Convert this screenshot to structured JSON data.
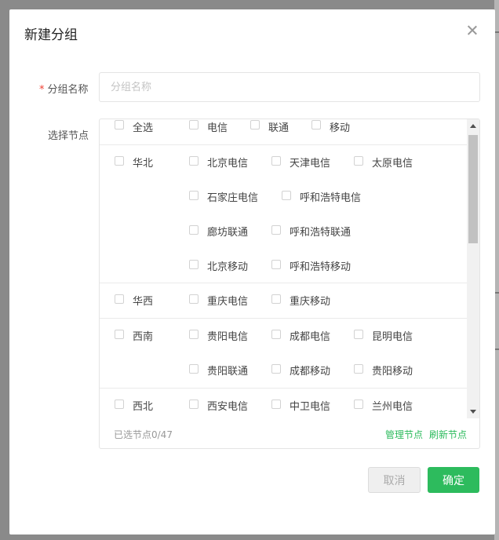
{
  "dialog": {
    "title": "新建分组",
    "group_name_label": "分组名称",
    "group_name_placeholder": "分组名称",
    "group_name_value": "",
    "required_mark": "*",
    "select_nodes_label": "选择节点"
  },
  "filters": {
    "all": "全选",
    "telecom": "电信",
    "unicom": "联通",
    "mobile": "移动"
  },
  "regions": [
    {
      "name": "华北",
      "nodes": [
        "北京电信",
        "天津电信",
        "太原电信",
        "石家庄电信",
        "呼和浩特电信",
        "廊坊联通",
        "呼和浩特联通",
        "北京移动",
        "呼和浩特移动"
      ]
    },
    {
      "name": "华西",
      "nodes": [
        "重庆电信",
        "重庆移动"
      ]
    },
    {
      "name": "西南",
      "nodes": [
        "贵阳电信",
        "成都电信",
        "昆明电信",
        "贵阳联通",
        "成都移动",
        "贵阳移动"
      ]
    },
    {
      "name": "西北",
      "nodes": [
        "西安电信",
        "中卫电信",
        "兰州电信"
      ]
    }
  ],
  "footer": {
    "selected_count": "已选节点0/47",
    "manage_nodes": "管理节点",
    "refresh_nodes": "刷新节点"
  },
  "buttons": {
    "cancel": "取消",
    "confirm": "确定"
  },
  "colors": {
    "accent": "#2dbb5d",
    "required": "#f04134"
  },
  "icons": {
    "close": "close-icon",
    "scroll_up": "chevron-up-icon",
    "scroll_down": "chevron-down-icon"
  }
}
